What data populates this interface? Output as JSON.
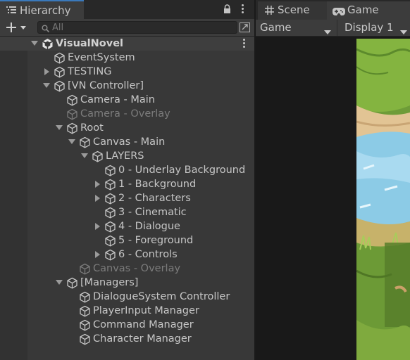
{
  "hierarchy": {
    "tab_label": "Hierarchy",
    "search_placeholder": "All",
    "rows": [
      {
        "label": "VisualNovel",
        "type": "scene"
      },
      {
        "label": "EventSystem",
        "active": true
      },
      {
        "label": "TESTING",
        "expander": "collapsed",
        "active": true
      },
      {
        "label": "[VN Controller]",
        "expander": "expanded",
        "active": true
      },
      {
        "label": "Camera - Main",
        "active": true
      },
      {
        "label": "Camera - Overlay",
        "active": false
      },
      {
        "label": "Root",
        "expander": "expanded",
        "active": true
      },
      {
        "label": "Canvas - Main",
        "expander": "expanded",
        "active": true
      },
      {
        "label": "LAYERS",
        "expander": "expanded",
        "active": true
      },
      {
        "label": "0 - Underlay Background",
        "active": true
      },
      {
        "label": "1 - Background",
        "expander": "collapsed",
        "active": true
      },
      {
        "label": "2 - Characters",
        "expander": "collapsed",
        "active": true
      },
      {
        "label": "3 - Cinematic",
        "active": true
      },
      {
        "label": "4 - Dialogue",
        "expander": "collapsed",
        "active": true
      },
      {
        "label": "5 - Foreground",
        "active": true
      },
      {
        "label": "6 - Controls",
        "expander": "collapsed",
        "active": true
      },
      {
        "label": "Canvas - Overlay",
        "active": false
      },
      {
        "label": "[Managers]",
        "expander": "expanded",
        "active": true
      },
      {
        "label": "DialogueSystem Controller",
        "active": true
      },
      {
        "label": "PlayerInput Manager",
        "active": true
      },
      {
        "label": "Command Manager",
        "active": true
      },
      {
        "label": "Character Manager",
        "active": true
      }
    ]
  },
  "game": {
    "tabs": [
      {
        "label": "Scene",
        "icon": "hash-grid-icon"
      },
      {
        "label": "Game",
        "icon": "gamepad-icon"
      }
    ],
    "view_dropdown": "Game",
    "display_dropdown": "Display 1"
  },
  "colors": {
    "panel_bg": "#383838",
    "tab_accent": "#3a79bb",
    "disabled_text": "#7b7b7b"
  }
}
